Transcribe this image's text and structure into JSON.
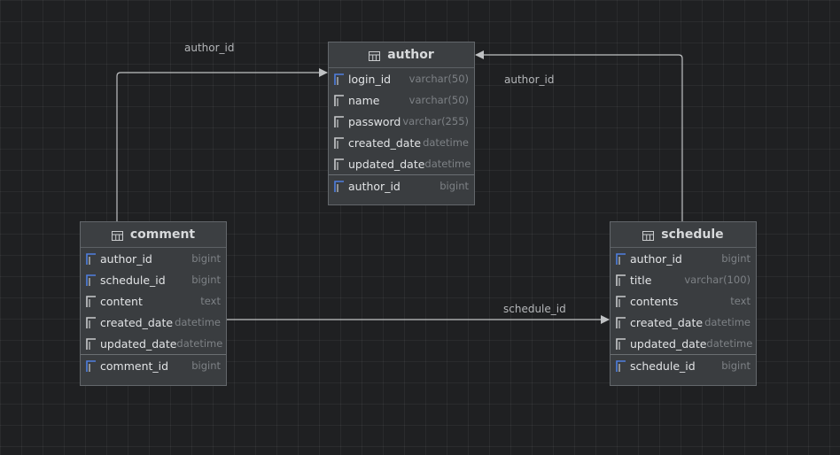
{
  "entities": {
    "author": {
      "name": "author",
      "fields": [
        {
          "name": "login_id",
          "type": "varchar(50)",
          "key": true
        },
        {
          "name": "name",
          "type": "varchar(50)",
          "key": false
        },
        {
          "name": "password",
          "type": "varchar(255)",
          "key": false
        },
        {
          "name": "created_date",
          "type": "datetime",
          "key": false
        },
        {
          "name": "updated_date",
          "type": "datetime",
          "key": false
        }
      ],
      "primary": {
        "name": "author_id",
        "type": "bigint"
      }
    },
    "comment": {
      "name": "comment",
      "fields": [
        {
          "name": "author_id",
          "type": "bigint",
          "key": true
        },
        {
          "name": "schedule_id",
          "type": "bigint",
          "key": true
        },
        {
          "name": "content",
          "type": "text",
          "key": false
        },
        {
          "name": "created_date",
          "type": "datetime",
          "key": false
        },
        {
          "name": "updated_date",
          "type": "datetime",
          "key": false
        }
      ],
      "primary": {
        "name": "comment_id",
        "type": "bigint"
      }
    },
    "schedule": {
      "name": "schedule",
      "fields": [
        {
          "name": "author_id",
          "type": "bigint",
          "key": true
        },
        {
          "name": "title",
          "type": "varchar(100)",
          "key": false
        },
        {
          "name": "contents",
          "type": "text",
          "key": false
        },
        {
          "name": "created_date",
          "type": "datetime",
          "key": false
        },
        {
          "name": "updated_date",
          "type": "datetime",
          "key": false
        }
      ],
      "primary": {
        "name": "schedule_id",
        "type": "bigint"
      }
    }
  },
  "relations": [
    {
      "label": "author_id",
      "from": "comment",
      "to": "author"
    },
    {
      "label": "author_id",
      "from": "schedule",
      "to": "author"
    },
    {
      "label": "schedule_id",
      "from": "comment",
      "to": "schedule"
    }
  ],
  "colors": {
    "key_icon": "#4f7fe0",
    "plain_icon": "#c9cbcd",
    "link_line": "#bfc1c3"
  }
}
